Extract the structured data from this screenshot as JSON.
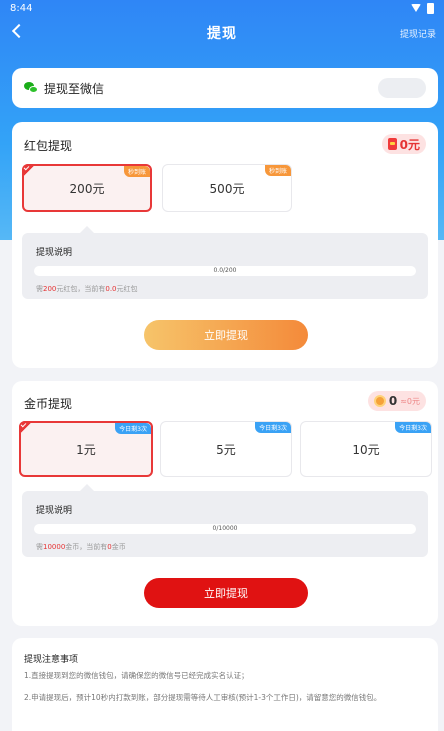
{
  "status_bar": {
    "time": "8:44"
  },
  "nav": {
    "title": "提现",
    "right_link": "提现记录"
  },
  "wechat": {
    "label": "提现至微信"
  },
  "red_packet": {
    "title": "红包提现",
    "balance": "0元",
    "options": [
      {
        "amount": "200元",
        "badge": "秒到账",
        "selected": true
      },
      {
        "amount": "500元",
        "badge": "秒到账",
        "selected": false
      }
    ],
    "explain_title": "提现说明",
    "progress_text": "0.0/200",
    "progress": 0.0,
    "note_prefix": "需",
    "note_need": "200",
    "note_mid": "元红包，当前有",
    "note_have": "0.0",
    "note_suffix": "元红包",
    "button": "立即提现"
  },
  "coins": {
    "title": "金币提现",
    "balance_value": "0",
    "balance_unit": "≈0元",
    "options": [
      {
        "amount": "1元",
        "badge": "今日剩3次",
        "selected": true
      },
      {
        "amount": "5元",
        "badge": "今日剩3次",
        "selected": false
      },
      {
        "amount": "10元",
        "badge": "今日剩3次",
        "selected": false
      }
    ],
    "explain_title": "提现说明",
    "progress_text": "0/10000",
    "progress": 0.0,
    "note_prefix": "需",
    "note_need": "10000",
    "note_mid": "金币，当前有",
    "note_have": "0",
    "note_suffix": "金币",
    "button": "立即提现"
  },
  "notes": {
    "title": "提现注意事项",
    "line1": "1.直接提现到您的微信钱包，请确保您的微信号已经完成实名认证；",
    "line2": "2.申请提现后，预计10秒内打款到账，部分提现需等待人工审核(预计1-3个工作日)，请留意您的微信钱包。"
  },
  "colors": {
    "primary": "#2f86f6",
    "accent_red": "#e83838",
    "button_red": "#e01212",
    "button_orange": "#f48a3a"
  }
}
